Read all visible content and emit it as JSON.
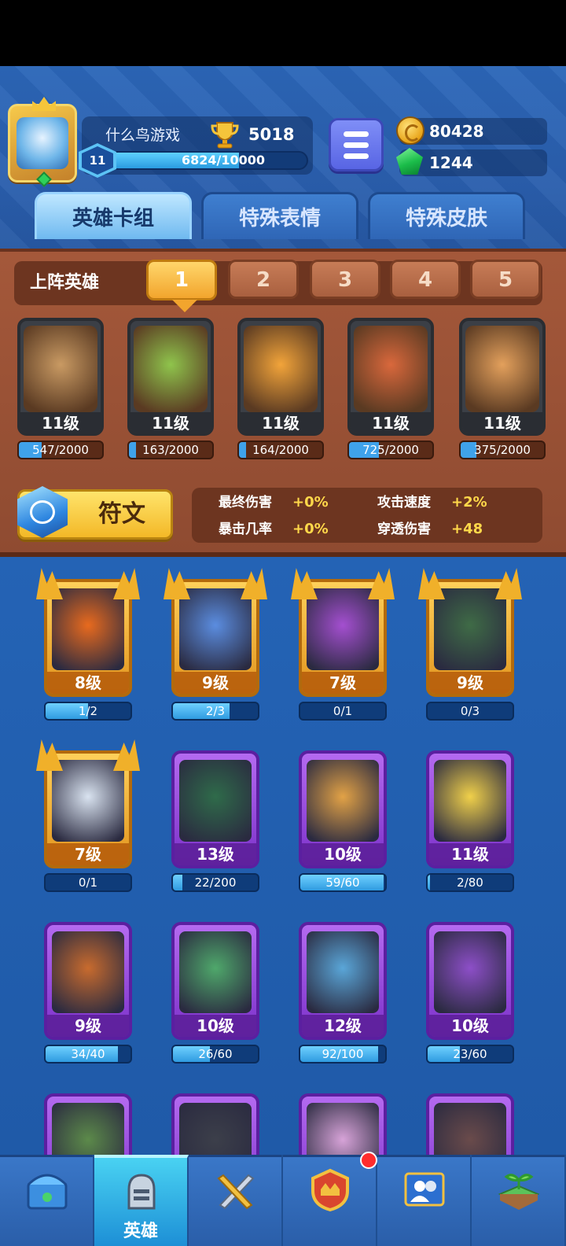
{
  "player": {
    "name": "什么鸟游戏",
    "trophies": "5018",
    "level": "11",
    "xp_text": "6824/10000",
    "xp_progress": 0.6824
  },
  "currency": {
    "gold": "80428",
    "gems": "1244"
  },
  "tabs": [
    {
      "label": "英雄卡组",
      "active": true
    },
    {
      "label": "特殊表情",
      "active": false
    },
    {
      "label": "特殊皮肤",
      "active": false
    }
  ],
  "deck": {
    "label": "上阵英雄",
    "slots": [
      "1",
      "2",
      "3",
      "4",
      "5"
    ],
    "active_slot": "1",
    "heroes": [
      {
        "level": "11级",
        "progress_text": "547/2000",
        "progress": 0.2735,
        "icon": "hero-rock-golem-icon"
      },
      {
        "level": "11级",
        "progress_text": "163/2000",
        "progress": 0.0815,
        "icon": "hero-hooded-archer-icon"
      },
      {
        "level": "11级",
        "progress_text": "164/2000",
        "progress": 0.082,
        "icon": "hero-tiki-mask-icon"
      },
      {
        "level": "11级",
        "progress_text": "725/2000",
        "progress": 0.3625,
        "icon": "hero-goggles-bomber-icon"
      },
      {
        "level": "11级",
        "progress_text": "375/2000",
        "progress": 0.1875,
        "icon": "hero-knight-gunner-icon"
      }
    ]
  },
  "runes": {
    "button_label": "符文",
    "stats": [
      {
        "label": "最终伤害",
        "value": "+0%"
      },
      {
        "label": "攻击速度",
        "value": "+2%"
      },
      {
        "label": "暴击几率",
        "value": "+0%"
      },
      {
        "label": "穿透伤害",
        "value": "+48"
      }
    ]
  },
  "collection": [
    {
      "level": "8级",
      "progress_text": "1/2",
      "progress": 0.5,
      "rarity": "legendary",
      "icon": "hero-fire-monk-icon"
    },
    {
      "level": "9级",
      "progress_text": "2/3",
      "progress": 0.667,
      "rarity": "legendary",
      "icon": "hero-ice-king-icon"
    },
    {
      "level": "7级",
      "progress_text": "0/1",
      "progress": 0,
      "rarity": "legendary",
      "icon": "hero-skull-mage-icon"
    },
    {
      "level": "9级",
      "progress_text": "0/3",
      "progress": 0,
      "rarity": "legendary",
      "icon": "hero-zombie-icon"
    },
    {
      "level": "7级",
      "progress_text": "0/1",
      "progress": 0,
      "rarity": "legendary",
      "icon": "hero-zeus-icon"
    },
    {
      "level": "13级",
      "progress_text": "22/200",
      "progress": 0.11,
      "rarity": "epic",
      "icon": "hero-skeleton-hat-icon"
    },
    {
      "level": "10级",
      "progress_text": "59/60",
      "progress": 0.983,
      "rarity": "epic",
      "icon": "hero-sign-bean-icon"
    },
    {
      "level": "11级",
      "progress_text": "2/80",
      "progress": 0.025,
      "rarity": "epic",
      "icon": "hero-astronaut-icon"
    },
    {
      "level": "9级",
      "progress_text": "34/40",
      "progress": 0.85,
      "rarity": "epic",
      "icon": "hero-lava-golem-icon"
    },
    {
      "level": "10级",
      "progress_text": "26/60",
      "progress": 0.433,
      "rarity": "epic",
      "icon": "hero-goggle-bot-icon"
    },
    {
      "level": "12级",
      "progress_text": "92/100",
      "progress": 0.92,
      "rarity": "epic",
      "icon": "hero-wind-hero-icon"
    },
    {
      "level": "10级",
      "progress_text": "23/60",
      "progress": 0.383,
      "rarity": "epic",
      "icon": "hero-magician-icon"
    },
    {
      "level": "",
      "progress_text": "",
      "progress": 0,
      "rarity": "epic",
      "icon": "hero-ranger-icon"
    },
    {
      "level": "",
      "progress_text": "",
      "progress": 0,
      "rarity": "epic",
      "icon": "hero-penguin-icon"
    },
    {
      "level": "",
      "progress_text": "",
      "progress": 0,
      "rarity": "epic",
      "icon": "hero-priestess-icon"
    },
    {
      "level": "",
      "progress_text": "",
      "progress": 0,
      "rarity": "epic",
      "icon": "hero-bomb-icon"
    }
  ],
  "bottom_nav": [
    {
      "label": "",
      "icon": "treasure-chest-icon",
      "active": false
    },
    {
      "label": "英雄",
      "icon": "knight-helmet-icon",
      "active": true
    },
    {
      "label": "",
      "icon": "crossed-swords-icon",
      "active": false
    },
    {
      "label": "",
      "icon": "crown-shield-icon",
      "active": false,
      "notify": true
    },
    {
      "label": "",
      "icon": "friends-icon",
      "active": false
    },
    {
      "label": "",
      "icon": "sprout-island-icon",
      "active": false
    }
  ],
  "colors": {
    "gold_frame": "#ffd05a",
    "purple_frame": "#b46af0",
    "wood_panel": "#a4583a",
    "progress_blue": "#3fa2ea"
  }
}
